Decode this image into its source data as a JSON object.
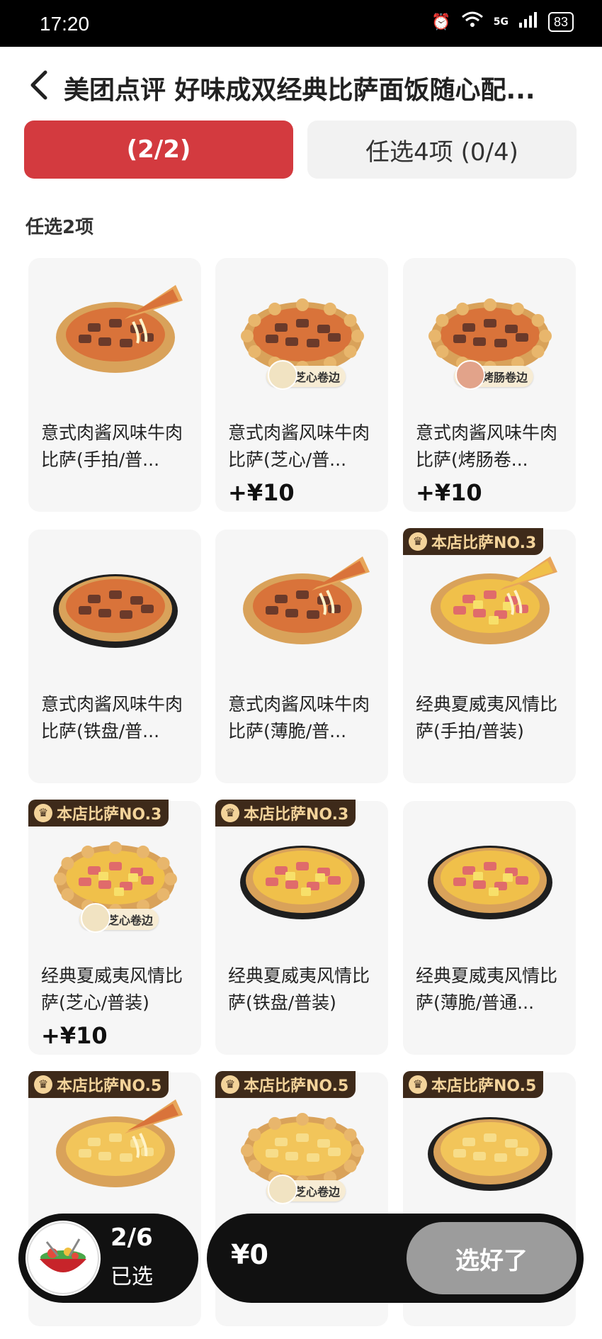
{
  "status_bar": {
    "time": "17:20",
    "network": "5G",
    "battery": "83"
  },
  "header": {
    "title": "美团点评 好味成双经典比萨面饭随心配..."
  },
  "tabs": [
    {
      "label": "(2/2)",
      "active": true
    },
    {
      "label": "任选4项 (0/4)",
      "active": false
    }
  ],
  "section": {
    "title": "任选2项"
  },
  "items": [
    {
      "name": "意式肉酱风味牛肉比萨(手拍/普...",
      "price": "",
      "badge": "",
      "crust_tag": "",
      "style": "slice-meat"
    },
    {
      "name": "意式肉酱风味牛肉比萨(芝心/普...",
      "price": "+¥10",
      "badge": "",
      "crust_tag": "芝心卷边",
      "style": "stuffed-meat"
    },
    {
      "name": "意式肉酱风味牛肉比萨(烤肠卷...",
      "price": "+¥10",
      "badge": "",
      "crust_tag": "烤肠卷边",
      "style": "sausage-meat"
    },
    {
      "name": "意式肉酱风味牛肉比萨(铁盘/普...",
      "price": "",
      "badge": "",
      "crust_tag": "",
      "style": "pan-meat"
    },
    {
      "name": "意式肉酱风味牛肉比萨(薄脆/普...",
      "price": "",
      "badge": "",
      "crust_tag": "",
      "style": "slice-meat"
    },
    {
      "name": "经典夏威夷风情比萨(手拍/普装)",
      "price": "",
      "badge": "本店比萨NO.3",
      "crust_tag": "",
      "style": "slice-hawaii"
    },
    {
      "name": "经典夏威夷风情比萨(芝心/普装)",
      "price": "+¥10",
      "badge": "本店比萨NO.3",
      "crust_tag": "芝心卷边",
      "style": "stuffed-hawaii"
    },
    {
      "name": "经典夏威夷风情比萨(铁盘/普装)",
      "price": "",
      "badge": "本店比萨NO.3",
      "crust_tag": "",
      "style": "pan-hawaii"
    },
    {
      "name": "经典夏威夷风情比萨(薄脆/普通...",
      "price": "",
      "badge": "",
      "crust_tag": "",
      "style": "thin-hawaii"
    },
    {
      "name": "",
      "price": "",
      "badge": "本店比萨NO.5",
      "crust_tag": "",
      "style": "slice-potato"
    },
    {
      "name": "",
      "price": "",
      "badge": "本店比萨NO.5",
      "crust_tag": "芝心卷边",
      "style": "stuffed-potato"
    },
    {
      "name": "",
      "price": "",
      "badge": "本店比萨NO.5",
      "crust_tag": "",
      "style": "pan-potato"
    }
  ],
  "cart": {
    "count": "2/6",
    "selected_label": "已选"
  },
  "checkout": {
    "total": "¥0",
    "done_label": "选好了"
  },
  "colors": {
    "accent": "#d33a3f",
    "badge_bg": "#3e2a1a",
    "badge_text": "#f3d39a"
  }
}
